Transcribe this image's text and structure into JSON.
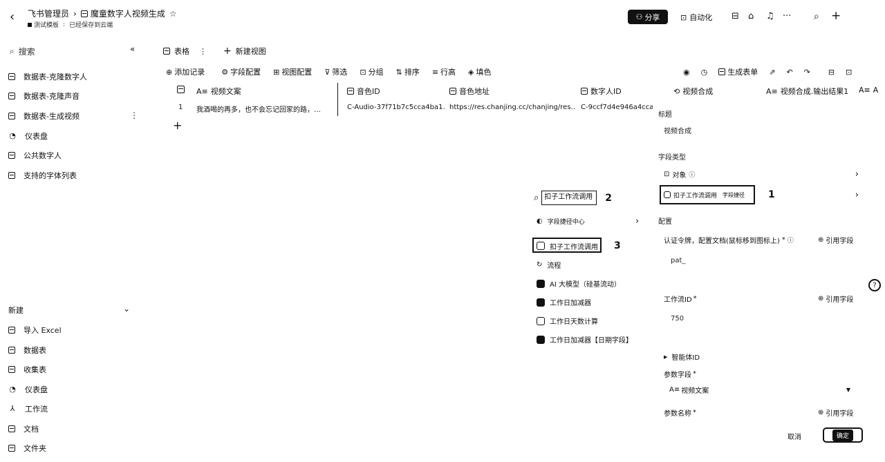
{
  "header": {
    "workspace": "飞书管理员",
    "doc_title": "魔童数字人视频生成",
    "status_tag": "测试模板",
    "save_status": "已经保存到云端",
    "share_label": "分享",
    "automation_label": "自动化"
  },
  "sidebar": {
    "search_placeholder": "搜索",
    "tables": [
      {
        "label": "数据表-克隆数字人",
        "icon": "table-icon"
      },
      {
        "label": "数据表-克隆声音",
        "icon": "table-icon"
      },
      {
        "label": "数据表-生成视频",
        "icon": "table-icon"
      },
      {
        "label": "仪表盘",
        "icon": "dashboard-icon"
      },
      {
        "label": "公共数字人",
        "icon": "table-icon"
      },
      {
        "label": "支持的字体列表",
        "icon": "table-icon"
      }
    ],
    "new_section": "新建",
    "new_items": [
      {
        "label": "导入 Excel",
        "icon": "excel-icon"
      },
      {
        "label": "数据表",
        "icon": "table-icon"
      },
      {
        "label": "收集表",
        "icon": "form-icon"
      },
      {
        "label": "仪表盘",
        "icon": "dashboard-icon"
      },
      {
        "label": "工作流",
        "icon": "workflow-icon"
      },
      {
        "label": "文档",
        "icon": "doc-icon"
      },
      {
        "label": "文件夹",
        "icon": "folder-icon"
      }
    ]
  },
  "views": {
    "current_view": "表格",
    "add_view": "新建视图"
  },
  "toolbar": {
    "add_record": "添加记录",
    "field_config": "字段配置",
    "view_config": "视图配置",
    "filter": "筛选",
    "group": "分组",
    "sort": "排序",
    "row_height": "行高",
    "fill_color": "填色",
    "generate_form": "生成表单"
  },
  "grid": {
    "columns": [
      "视频文案",
      "音色ID",
      "音色地址",
      "数字人ID",
      "视频合成",
      "视频合成.输出结果1",
      "A"
    ],
    "rows": [
      {
        "index": "1",
        "text": "我酒喝的再多，也不会忘记回家的路，…",
        "voice_id": "C-Audio-37f71b7c5cca4ba1…",
        "voice_url": "https://res.chanjing.cc/chanjing/res…",
        "avatar_id": "C-9ccf7d4e946a4ccab"
      }
    ]
  },
  "dropdown": {
    "search_value": "扣子工作流调用",
    "step2": "2",
    "step3": "3",
    "items": [
      {
        "label": "字段捷径中心",
        "icon": "shortcut-center-icon",
        "has_arrow": true
      },
      {
        "label": "扣子工作流调用",
        "icon": "coze-icon"
      },
      {
        "label": "流程",
        "icon": "flow-icon"
      },
      {
        "label": "AI 大模型（硅基流动）",
        "icon": "ai-icon"
      },
      {
        "label": "工作日加减器",
        "icon": "workday-icon"
      },
      {
        "label": "工作日天数计算",
        "icon": "workday-count-icon"
      },
      {
        "label": "工作日加减器【日期字段】",
        "icon": "workday-date-icon"
      }
    ]
  },
  "config": {
    "title_label": "标题",
    "title_value": "视频合成",
    "field_type_label": "字段类型",
    "type_object": "对象",
    "type_selected": "扣子工作流调用",
    "type_tag": "字段捷径",
    "step1": "1",
    "config_label": "配置",
    "token_label": "认证令牌，配置文档(鼠标移到图标上)",
    "token_value": "pat_",
    "cite_field": "引用字段",
    "workflow_label": "工作流ID",
    "workflow_value": "750",
    "agent_label": "智能体ID",
    "param_field_label": "参数字段",
    "param_field_value": "视频文案",
    "param_name_label": "参数名称",
    "cancel": "取消",
    "ok": "确定"
  }
}
